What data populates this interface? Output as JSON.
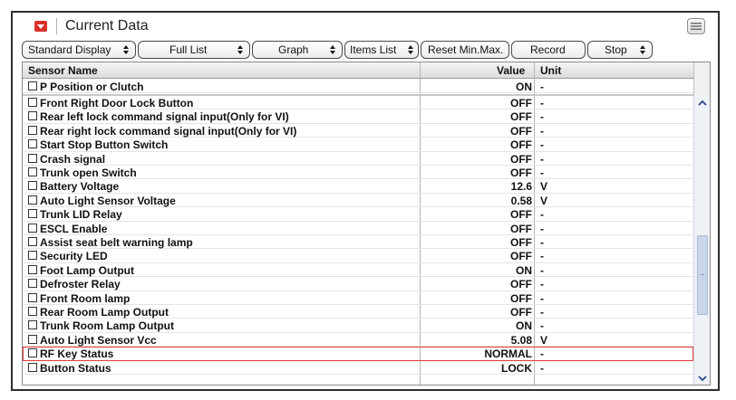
{
  "window": {
    "title": "Current Data",
    "title_icon": "dropdown-arrow-icon",
    "menu_icon": "panel-menu-icon"
  },
  "toolbar": {
    "standard_display": "Standard Display",
    "full_list": "Full List",
    "graph": "Graph",
    "items_list": "Items List",
    "reset_minmax": "Reset Min.Max.",
    "record": "Record",
    "stop": "Stop"
  },
  "grid": {
    "headers": {
      "name": "Sensor Name",
      "value": "Value",
      "unit": "Unit"
    },
    "fixed_row": {
      "name": "P Position or Clutch",
      "value": "ON",
      "unit": "-"
    },
    "rows": [
      {
        "name": "Front Right Door Lock Button",
        "value": "OFF",
        "unit": "-"
      },
      {
        "name": "Rear left lock command signal input(Only for VI)",
        "value": "OFF",
        "unit": "-"
      },
      {
        "name": "Rear right lock command signal input(Only for VI)",
        "value": "OFF",
        "unit": "-"
      },
      {
        "name": "Start Stop Button Switch",
        "value": "OFF",
        "unit": "-"
      },
      {
        "name": "Crash signal",
        "value": "OFF",
        "unit": "-"
      },
      {
        "name": "Trunk open Switch",
        "value": "OFF",
        "unit": "-"
      },
      {
        "name": "Battery Voltage",
        "value": "12.6",
        "unit": "V"
      },
      {
        "name": "Auto Light Sensor Voltage",
        "value": "0.58",
        "unit": "V"
      },
      {
        "name": "Trunk LID Relay",
        "value": "OFF",
        "unit": "-"
      },
      {
        "name": "ESCL Enable",
        "value": "OFF",
        "unit": "-"
      },
      {
        "name": "Assist seat belt warning lamp",
        "value": "OFF",
        "unit": "-"
      },
      {
        "name": "Security LED",
        "value": "OFF",
        "unit": "-"
      },
      {
        "name": "Foot Lamp Output",
        "value": "ON",
        "unit": "-"
      },
      {
        "name": "Defroster Relay",
        "value": "OFF",
        "unit": "-"
      },
      {
        "name": "Front Room lamp",
        "value": "OFF",
        "unit": "-"
      },
      {
        "name": "Rear Room Lamp Output",
        "value": "OFF",
        "unit": "-"
      },
      {
        "name": "Trunk Room Lamp Output",
        "value": "ON",
        "unit": "-"
      },
      {
        "name": "Auto Light Sensor Vcc",
        "value": "5.08",
        "unit": "V"
      },
      {
        "name": "RF Key Status",
        "value": "NORMAL",
        "unit": "-",
        "highlighted": true
      },
      {
        "name": "Button Status",
        "value": "LOCK",
        "unit": "-"
      }
    ]
  },
  "colors": {
    "highlight_border": "#e23a3a",
    "title_icon": "#d9302b",
    "scroll_thumb": "#c9d6ea"
  }
}
